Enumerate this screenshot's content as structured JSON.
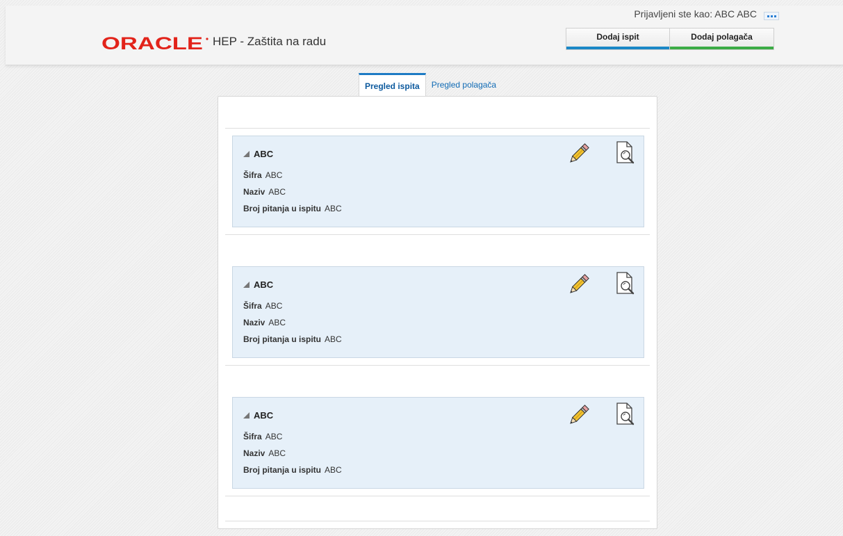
{
  "header": {
    "app_title": "HEP - Zaštita na radu",
    "user_label": "Prijavljeni ste kao: ABC ABC",
    "buttons": [
      {
        "label": "Dodaj ispit",
        "accent": "#1a87c6"
      },
      {
        "label": "Dodaj polagača",
        "accent": "#3bab45"
      }
    ]
  },
  "tabs": [
    {
      "label": "Pregled ispita",
      "active": true
    },
    {
      "label": "Pregled polagača",
      "active": false
    }
  ],
  "cards": [
    {
      "title": "ABC",
      "fields": [
        {
          "label": "Šifra",
          "value": "ABC"
        },
        {
          "label": "Naziv",
          "value": "ABC"
        },
        {
          "label": "Broj pitanja u ispitu",
          "value": "ABC"
        }
      ]
    },
    {
      "title": "ABC",
      "fields": [
        {
          "label": "Šifra",
          "value": "ABC"
        },
        {
          "label": "Naziv",
          "value": "ABC"
        },
        {
          "label": "Broj pitanja u ispitu",
          "value": "ABC"
        }
      ]
    },
    {
      "title": "ABC",
      "fields": [
        {
          "label": "Šifra",
          "value": "ABC"
        },
        {
          "label": "Naziv",
          "value": "ABC"
        },
        {
          "label": "Broj pitanja u ispitu",
          "value": "ABC"
        }
      ]
    }
  ],
  "icons": {
    "logo": "oracle-logo",
    "edit": "pencil-icon",
    "view": "document-search-icon",
    "collapse": "collapse-triangle-icon",
    "menu": "more-icon"
  },
  "colors": {
    "oracle_red": "#e2231a",
    "card_bg": "#e6f0f9",
    "tab_accent": "#1d7bc4"
  }
}
